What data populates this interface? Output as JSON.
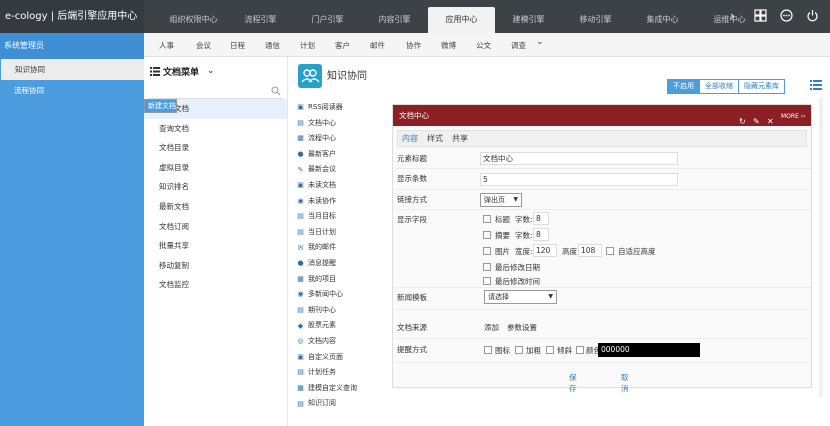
{
  "brand": "e-cology | 后端引擎应用中心",
  "top_tabs": [
    "组织权限中心",
    "流程引擎",
    "门户引擎",
    "内容引擎",
    "应用中心",
    "建模引擎",
    "移动引擎",
    "集成中心",
    "运维中心"
  ],
  "top_next": "›",
  "sub_tabs": [
    "人事",
    "会议",
    "日程",
    "通信",
    "计划",
    "客户",
    "邮件",
    "协作",
    "微博",
    "公文",
    "调查"
  ],
  "sub_more": "⌄",
  "left": {
    "header": "系统管理员",
    "items": [
      "知识协同",
      "流程协同"
    ]
  },
  "menu": {
    "title": "文档菜单",
    "caret": "⌄",
    "items": [
      "新建文档",
      "我的文档",
      "查询文档",
      "文档目录",
      "虚拟目录",
      "知识排名",
      "最新文档",
      "文档订阅",
      "批量共享",
      "移动复制",
      "文档监控"
    ]
  },
  "content": {
    "title": "知识协同",
    "buttons": [
      "不启用",
      "全部收缩",
      "隐藏元素库"
    ]
  },
  "portlets": [
    {
      "icon": "rss-icon",
      "glyph": "▣",
      "label": "RSS阅读器"
    },
    {
      "icon": "doc-center-icon",
      "glyph": "▤",
      "label": "文档中心"
    },
    {
      "icon": "flow-center-icon",
      "glyph": "▦",
      "label": "流程中心"
    },
    {
      "icon": "customer-icon",
      "glyph": "●",
      "label": "最新客户"
    },
    {
      "icon": "meeting-icon",
      "glyph": "✎",
      "label": "最新会议"
    },
    {
      "icon": "unread-doc-icon",
      "glyph": "▣",
      "label": "未读文档"
    },
    {
      "icon": "unread-collab-icon",
      "glyph": "◉",
      "label": "未读协作"
    },
    {
      "icon": "month-goal-icon",
      "glyph": "▤",
      "label": "当月目标"
    },
    {
      "icon": "day-plan-icon",
      "glyph": "▤",
      "label": "当日计划"
    },
    {
      "icon": "mail-icon",
      "glyph": "✉",
      "label": "我的邮件"
    },
    {
      "icon": "message-icon",
      "glyph": "●",
      "label": "消息提醒"
    },
    {
      "icon": "project-icon",
      "glyph": "▦",
      "label": "我的项目"
    },
    {
      "icon": "multi-news-icon",
      "glyph": "◉",
      "label": "多新闻中心"
    },
    {
      "icon": "periodical-icon",
      "glyph": "▤",
      "label": "期刊中心"
    },
    {
      "icon": "stock-icon",
      "glyph": "◆",
      "label": "股票元素"
    },
    {
      "icon": "doc-content-icon",
      "glyph": "◎",
      "label": "文档内容"
    },
    {
      "icon": "custom-page-icon",
      "glyph": "▣",
      "label": "自定义页面"
    },
    {
      "icon": "plan-task-icon",
      "glyph": "▤",
      "label": "计划任务"
    },
    {
      "icon": "model-query-icon",
      "glyph": "▦",
      "label": "建模自定义查询"
    },
    {
      "icon": "knowledge-sub-icon",
      "glyph": "▤",
      "label": "知识订阅"
    }
  ],
  "panel": {
    "title": "文档中心",
    "more": "MORE ››",
    "tabs": [
      "内容",
      "样式",
      "共享"
    ],
    "fields": {
      "title_label": "元素标题",
      "title_value": "文档中心",
      "count_label": "显示条数",
      "count_value": "5",
      "link_label": "链接方式",
      "link_value": "弹出页",
      "display_label": "显示字段",
      "f_title": "标题",
      "f_words": "字数:",
      "f_title_words": "8",
      "f_summary": "摘要",
      "f_summary_words": "8",
      "f_image": "图片",
      "f_width": "宽度:",
      "f_width_value": "120",
      "f_height": "高度:",
      "f_height_value": "108",
      "f_auto": "自适应高度",
      "f_last_date": "最后修改日期",
      "f_last_time": "最后修改时间",
      "template_label": "新闻模板",
      "template_value": "请选择",
      "source_label": "文档来源",
      "source_add": "添加",
      "source_param": "参数设置",
      "remind_label": "提醒方式",
      "r_icon": "图标",
      "r_bold": "加粗",
      "r_italic": "倾斜",
      "r_color": "颜色",
      "r_color_value": "000000"
    },
    "save": "保存",
    "cancel": "取消"
  }
}
